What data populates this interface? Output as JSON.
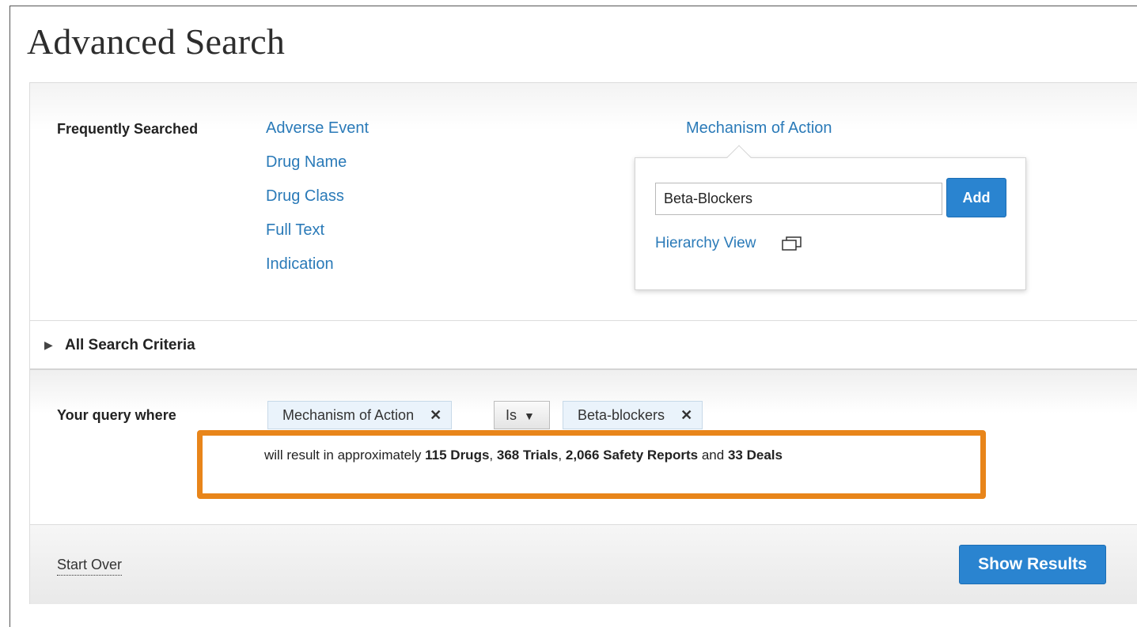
{
  "page": {
    "title": "Advanced Search"
  },
  "frequently_searched": {
    "label": "Frequently Searched",
    "links": [
      "Adverse Event",
      "Drug Name",
      "Drug Class",
      "Full Text",
      "Indication"
    ],
    "active_link": "Mechanism of Action"
  },
  "popup": {
    "input_value": "Beta-Blockers",
    "add_label": "Add",
    "hierarchy_label": "Hierarchy View",
    "hierarchy_icon": "new-window-icon"
  },
  "criteria": {
    "label": "All Search Criteria",
    "icon": "triangle-right-icon"
  },
  "query": {
    "label": "Your query where",
    "field_chip": "Mechanism of Action",
    "operator": "Is",
    "value_chip": "Beta-blockers",
    "remove_glyph": "✕",
    "dropdown_glyph": "▼",
    "result": {
      "prefix": "will result in approximately",
      "drugs": "115 Drugs",
      "sep1": ",",
      "trials": "368 Trials",
      "sep2": ",",
      "reports": "2,066 Safety Reports",
      "conj": "and",
      "deals": "33 Deals"
    }
  },
  "footer": {
    "start_over": "Start Over",
    "show_results": "Show Results"
  },
  "colors": {
    "link": "#2a7ab8",
    "primary_button": "#2a84d0",
    "highlight_border": "#e8851a",
    "chip_bg": "#eaf3fb"
  }
}
